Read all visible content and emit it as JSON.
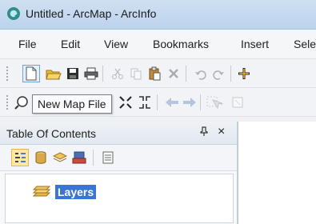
{
  "window": {
    "title": "Untitled - ArcMap - ArcInfo"
  },
  "menu": {
    "items": [
      "File",
      "Edit",
      "View",
      "Bookmarks",
      "Insert",
      "Sele"
    ]
  },
  "toolbar": {
    "tooltip": "New Map File"
  },
  "toc": {
    "title": "Table Of Contents",
    "pin": "ᵖ",
    "close": "×",
    "layers_label": "Layers"
  },
  "colors": {
    "selection": "#3a74d6",
    "titlebar": "#c6daf0"
  }
}
